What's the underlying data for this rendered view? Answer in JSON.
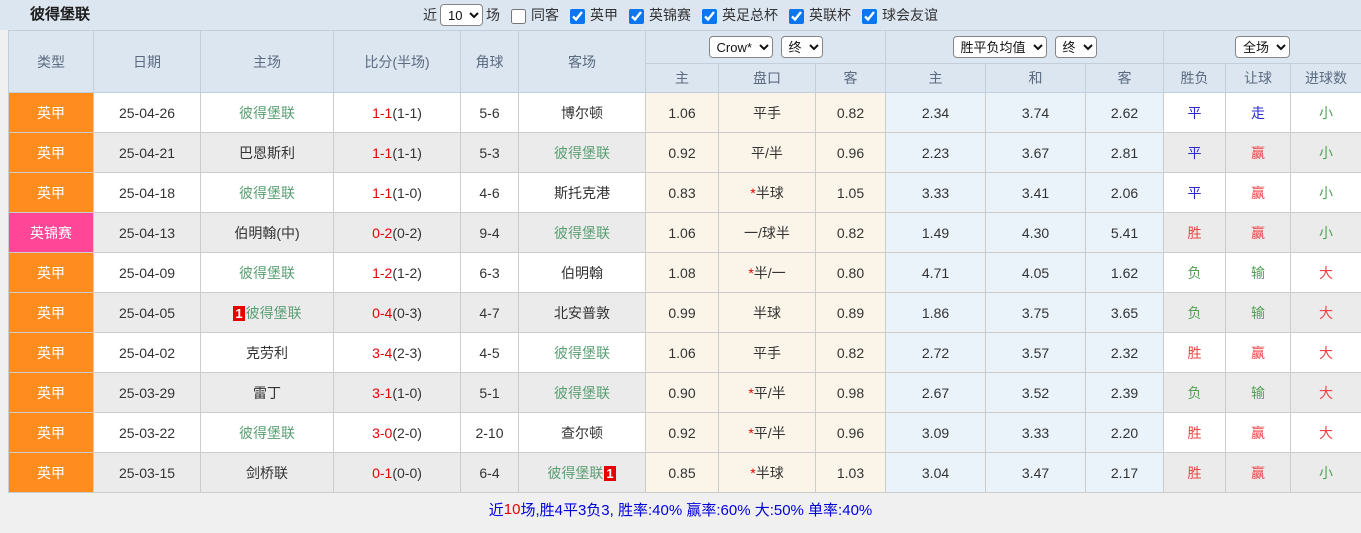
{
  "header": {
    "title": "彼得堡联",
    "near_label": "近",
    "matches_value": "10",
    "matches_label": "场",
    "toggles": [
      {
        "label": "同客",
        "checked": false
      },
      {
        "label": "英甲",
        "checked": true
      },
      {
        "label": "英锦赛",
        "checked": true
      },
      {
        "label": "英足总杯",
        "checked": true
      },
      {
        "label": "英联杯",
        "checked": true
      },
      {
        "label": "球会友谊",
        "checked": true
      }
    ]
  },
  "table": {
    "selects": {
      "company": "Crow*",
      "company_state": "终",
      "europe": "胜平负均值",
      "europe_state": "终",
      "scope": "全场"
    },
    "headers": {
      "type": "类型",
      "date": "日期",
      "home": "主场",
      "score": "比分(半场)",
      "corner": "角球",
      "away": "客场",
      "ah_home": "主",
      "ah_line": "盘口",
      "ah_away": "客",
      "eu_home": "主",
      "eu_draw": "和",
      "eu_away": "客",
      "result": "胜负",
      "spread": "让球",
      "goals": "进球数"
    },
    "rows": [
      {
        "league": "英甲",
        "league_class": "type-orange",
        "date": "25-04-26",
        "home_badge": "",
        "home": "彼得堡联",
        "home_class": "team-green",
        "score_ft": "1-1",
        "score_ht": "(1-1)",
        "corner": "5-6",
        "away": "博尔顿",
        "away_class": "team-black",
        "away_badge": "",
        "ah_home": "1.06",
        "star": "",
        "ah_line": "平手",
        "ah_away": "0.82",
        "eu_home": "2.34",
        "eu_draw": "3.74",
        "eu_away": "2.62",
        "result": "平",
        "result_class": "blue",
        "spread": "走",
        "spread_class": "blue",
        "goals": "小",
        "goals_class": "green"
      },
      {
        "league": "英甲",
        "league_class": "type-orange",
        "date": "25-04-21",
        "home_badge": "",
        "home": "巴恩斯利",
        "home_class": "team-black",
        "score_ft": "1-1",
        "score_ht": "(1-1)",
        "corner": "5-3",
        "away": "彼得堡联",
        "away_class": "team-green",
        "away_badge": "",
        "ah_home": "0.92",
        "star": "",
        "ah_line": "平/半",
        "ah_away": "0.96",
        "eu_home": "2.23",
        "eu_draw": "3.67",
        "eu_away": "2.81",
        "result": "平",
        "result_class": "blue",
        "spread": "赢",
        "spread_class": "red",
        "goals": "小",
        "goals_class": "green"
      },
      {
        "league": "英甲",
        "league_class": "type-orange",
        "date": "25-04-18",
        "home_badge": "",
        "home": "彼得堡联",
        "home_class": "team-green",
        "score_ft": "1-1",
        "score_ht": "(1-0)",
        "corner": "4-6",
        "away": "斯托克港",
        "away_class": "team-black",
        "away_badge": "",
        "ah_home": "0.83",
        "star": "*",
        "ah_line": "半球",
        "ah_away": "1.05",
        "eu_home": "3.33",
        "eu_draw": "3.41",
        "eu_away": "2.06",
        "result": "平",
        "result_class": "blue",
        "spread": "赢",
        "spread_class": "red",
        "goals": "小",
        "goals_class": "green"
      },
      {
        "league": "英锦赛",
        "league_class": "type-pink",
        "date": "25-04-13",
        "home_badge": "",
        "home": "伯明翰(中)",
        "home_class": "team-black",
        "score_ft": "0-2",
        "score_ht": "(0-2)",
        "corner": "9-4",
        "away": "彼得堡联",
        "away_class": "team-green",
        "away_badge": "",
        "ah_home": "1.06",
        "star": "",
        "ah_line": "一/球半",
        "ah_away": "0.82",
        "eu_home": "1.49",
        "eu_draw": "4.30",
        "eu_away": "5.41",
        "result": "胜",
        "result_class": "red",
        "spread": "赢",
        "spread_class": "red",
        "goals": "小",
        "goals_class": "green"
      },
      {
        "league": "英甲",
        "league_class": "type-orange",
        "date": "25-04-09",
        "home_badge": "",
        "home": "彼得堡联",
        "home_class": "team-green",
        "score_ft": "1-2",
        "score_ht": "(1-2)",
        "corner": "6-3",
        "away": "伯明翰",
        "away_class": "team-black",
        "away_badge": "",
        "ah_home": "1.08",
        "star": "*",
        "ah_line": "半/一",
        "ah_away": "0.80",
        "eu_home": "4.71",
        "eu_draw": "4.05",
        "eu_away": "1.62",
        "result": "负",
        "result_class": "green",
        "spread": "输",
        "spread_class": "green",
        "goals": "大",
        "goals_class": "red"
      },
      {
        "league": "英甲",
        "league_class": "type-orange",
        "date": "25-04-05",
        "home_badge": "1",
        "home": "彼得堡联",
        "home_class": "team-green",
        "score_ft": "0-4",
        "score_ht": "(0-3)",
        "corner": "4-7",
        "away": "北安普敦",
        "away_class": "team-black",
        "away_badge": "",
        "ah_home": "0.99",
        "star": "",
        "ah_line": "半球",
        "ah_away": "0.89",
        "eu_home": "1.86",
        "eu_draw": "3.75",
        "eu_away": "3.65",
        "result": "负",
        "result_class": "green",
        "spread": "输",
        "spread_class": "green",
        "goals": "大",
        "goals_class": "red"
      },
      {
        "league": "英甲",
        "league_class": "type-orange",
        "date": "25-04-02",
        "home_badge": "",
        "home": "克劳利",
        "home_class": "team-black",
        "score_ft": "3-4",
        "score_ht": "(2-3)",
        "corner": "4-5",
        "away": "彼得堡联",
        "away_class": "team-green",
        "away_badge": "",
        "ah_home": "1.06",
        "star": "",
        "ah_line": "平手",
        "ah_away": "0.82",
        "eu_home": "2.72",
        "eu_draw": "3.57",
        "eu_away": "2.32",
        "result": "胜",
        "result_class": "red",
        "spread": "赢",
        "spread_class": "red",
        "goals": "大",
        "goals_class": "red"
      },
      {
        "league": "英甲",
        "league_class": "type-orange",
        "date": "25-03-29",
        "home_badge": "",
        "home": "雷丁",
        "home_class": "team-black",
        "score_ft": "3-1",
        "score_ht": "(1-0)",
        "corner": "5-1",
        "away": "彼得堡联",
        "away_class": "team-green",
        "away_badge": "",
        "ah_home": "0.90",
        "star": "*",
        "ah_line": "平/半",
        "ah_away": "0.98",
        "eu_home": "2.67",
        "eu_draw": "3.52",
        "eu_away": "2.39",
        "result": "负",
        "result_class": "green",
        "spread": "输",
        "spread_class": "green",
        "goals": "大",
        "goals_class": "red"
      },
      {
        "league": "英甲",
        "league_class": "type-orange",
        "date": "25-03-22",
        "home_badge": "",
        "home": "彼得堡联",
        "home_class": "team-green",
        "score_ft": "3-0",
        "score_ht": "(2-0)",
        "corner": "2-10",
        "away": "查尔顿",
        "away_class": "team-black",
        "away_badge": "",
        "ah_home": "0.92",
        "star": "*",
        "ah_line": "平/半",
        "ah_away": "0.96",
        "eu_home": "3.09",
        "eu_draw": "3.33",
        "eu_away": "2.20",
        "result": "胜",
        "result_class": "red",
        "spread": "赢",
        "spread_class": "red",
        "goals": "大",
        "goals_class": "red"
      },
      {
        "league": "英甲",
        "league_class": "type-orange",
        "date": "25-03-15",
        "home_badge": "",
        "home": "剑桥联",
        "home_class": "team-black",
        "score_ft": "0-1",
        "score_ht": "(0-0)",
        "corner": "6-4",
        "away": "彼得堡联",
        "away_class": "team-green",
        "away_badge": "1",
        "ah_home": "0.85",
        "star": "*",
        "ah_line": "半球",
        "ah_away": "1.03",
        "eu_home": "3.04",
        "eu_draw": "3.47",
        "eu_away": "2.17",
        "result": "胜",
        "result_class": "red",
        "spread": "赢",
        "spread_class": "red",
        "goals": "小",
        "goals_class": "green"
      }
    ]
  },
  "summary": {
    "prefix": "近",
    "count": "10",
    "rest": "场,胜4平3负3, 胜率:40% 赢率:60% 大:50% 单率:40%"
  }
}
